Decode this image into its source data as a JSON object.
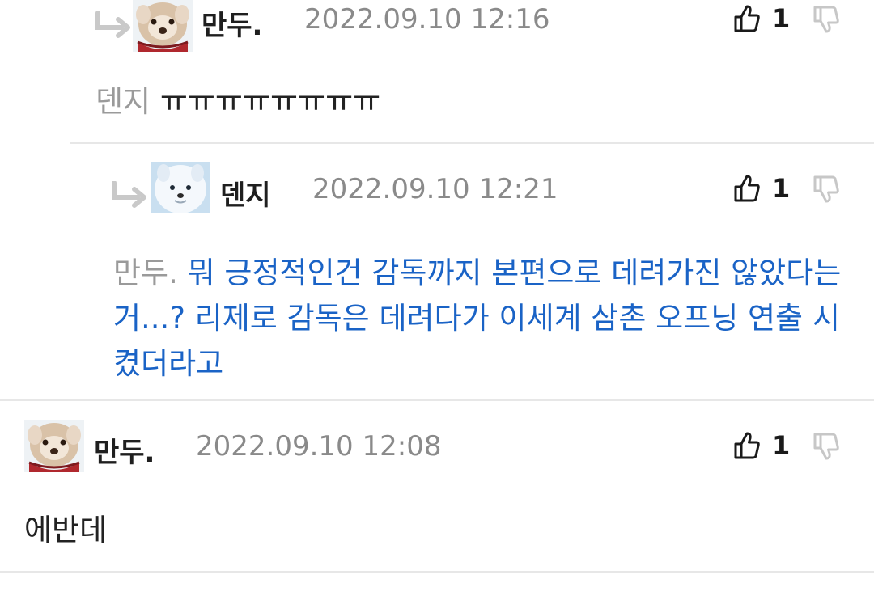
{
  "comments": [
    {
      "nickname": "만두.",
      "date": "2022.09.10 12:16",
      "likes": "1",
      "is_reply": true,
      "mention": "덴지",
      "text": "ㅠㅠㅠㅠㅠㅠㅠㅠ",
      "avatar": "dog-with-red-scarf"
    },
    {
      "nickname": "덴지",
      "date": "2022.09.10 12:21",
      "likes": "1",
      "is_reply": true,
      "mention": "만두.",
      "text": "뭐 긍정적인건 감독까지 본편으로 데려가진 않았다는거...? 리제로 감독은 데려다가 이세계 삼촌 오프닝 연출 시켰더라고",
      "avatar": "white-fluffy-dog"
    },
    {
      "nickname": "만두.",
      "date": "2022.09.10 12:08",
      "likes": "1",
      "is_reply": false,
      "text": "에반데",
      "avatar": "dog-with-red-scarf"
    }
  ],
  "colors": {
    "link_blue": "#1a63c6",
    "mention_gray": "#9a9a9a",
    "date_gray": "#8a8a8a"
  },
  "icons": {
    "reply": "reply-arrow-icon",
    "like": "thumbs-up-icon",
    "dislike": "thumbs-down-icon"
  }
}
